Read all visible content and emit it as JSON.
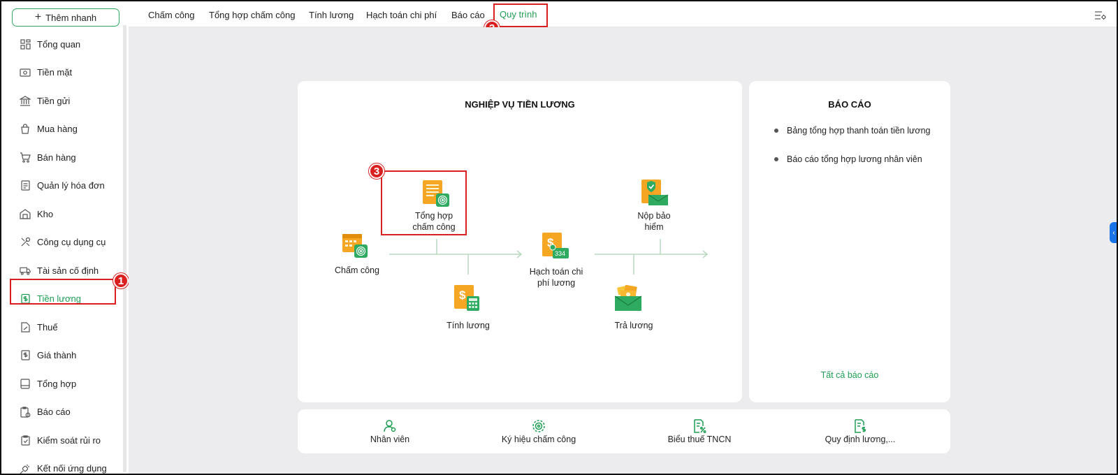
{
  "sidebar": {
    "quick_add": "Thêm nhanh",
    "items": [
      {
        "label": "Tổng quan",
        "icon": "dashboard-icon"
      },
      {
        "label": "Tiền mặt",
        "icon": "cash-icon"
      },
      {
        "label": "Tiền gửi",
        "icon": "bank-icon"
      },
      {
        "label": "Mua hàng",
        "icon": "shopping-bag-icon"
      },
      {
        "label": "Bán hàng",
        "icon": "cart-icon"
      },
      {
        "label": "Quản lý hóa đơn",
        "icon": "invoice-icon"
      },
      {
        "label": "Kho",
        "icon": "warehouse-icon"
      },
      {
        "label": "Công cụ dụng cụ",
        "icon": "tools-icon"
      },
      {
        "label": "Tài sản cố định",
        "icon": "truck-icon"
      },
      {
        "label": "Tiền lương",
        "icon": "payroll-icon"
      },
      {
        "label": "Thuế",
        "icon": "tax-icon"
      },
      {
        "label": "Giá thành",
        "icon": "price-icon"
      },
      {
        "label": "Tổng hợp",
        "icon": "summary-icon"
      },
      {
        "label": "Báo cáo",
        "icon": "report-icon"
      },
      {
        "label": "Kiểm soát rủi ro",
        "icon": "risk-icon"
      },
      {
        "label": "Kết nối ứng dụng",
        "icon": "plug-icon"
      }
    ],
    "active": "Tiền lương"
  },
  "tabs": [
    "Chấm công",
    "Tổng hợp chấm công",
    "Tính lương",
    "Hạch toán chi phí",
    "Báo cáo",
    "Quy trình"
  ],
  "active_tab": "Quy trình",
  "process": {
    "title": "NGHIỆP VỤ TIỀN LƯƠNG",
    "steps": {
      "timesheet": "Chấm công",
      "summary_line1": "Tổng hợp",
      "summary_line2": "chấm công",
      "salary": "Tính lương",
      "accounting_line1": "Hạch toán chi",
      "accounting_line2": "phí lương",
      "insurance_line1": "Nộp bảo",
      "insurance_line2": "hiểm",
      "payment": "Trả lương"
    },
    "acct_code": "334"
  },
  "reports": {
    "title": "BÁO CÁO",
    "items": [
      "Bảng tổng hợp thanh toán tiền lương",
      "Báo cáo tổng hợp lương nhân viên"
    ],
    "all_link": "Tất cả báo cáo"
  },
  "shortcuts": [
    "Nhân viên",
    "Ký hiệu chấm công",
    "Biểu thuế TNCN",
    "Quy định lương,..."
  ],
  "annotations": [
    "1",
    "2",
    "3"
  ],
  "colors": {
    "accent": "#1e9e54",
    "highlight": "#d91f1f",
    "icon_orange": "#f5a623"
  }
}
